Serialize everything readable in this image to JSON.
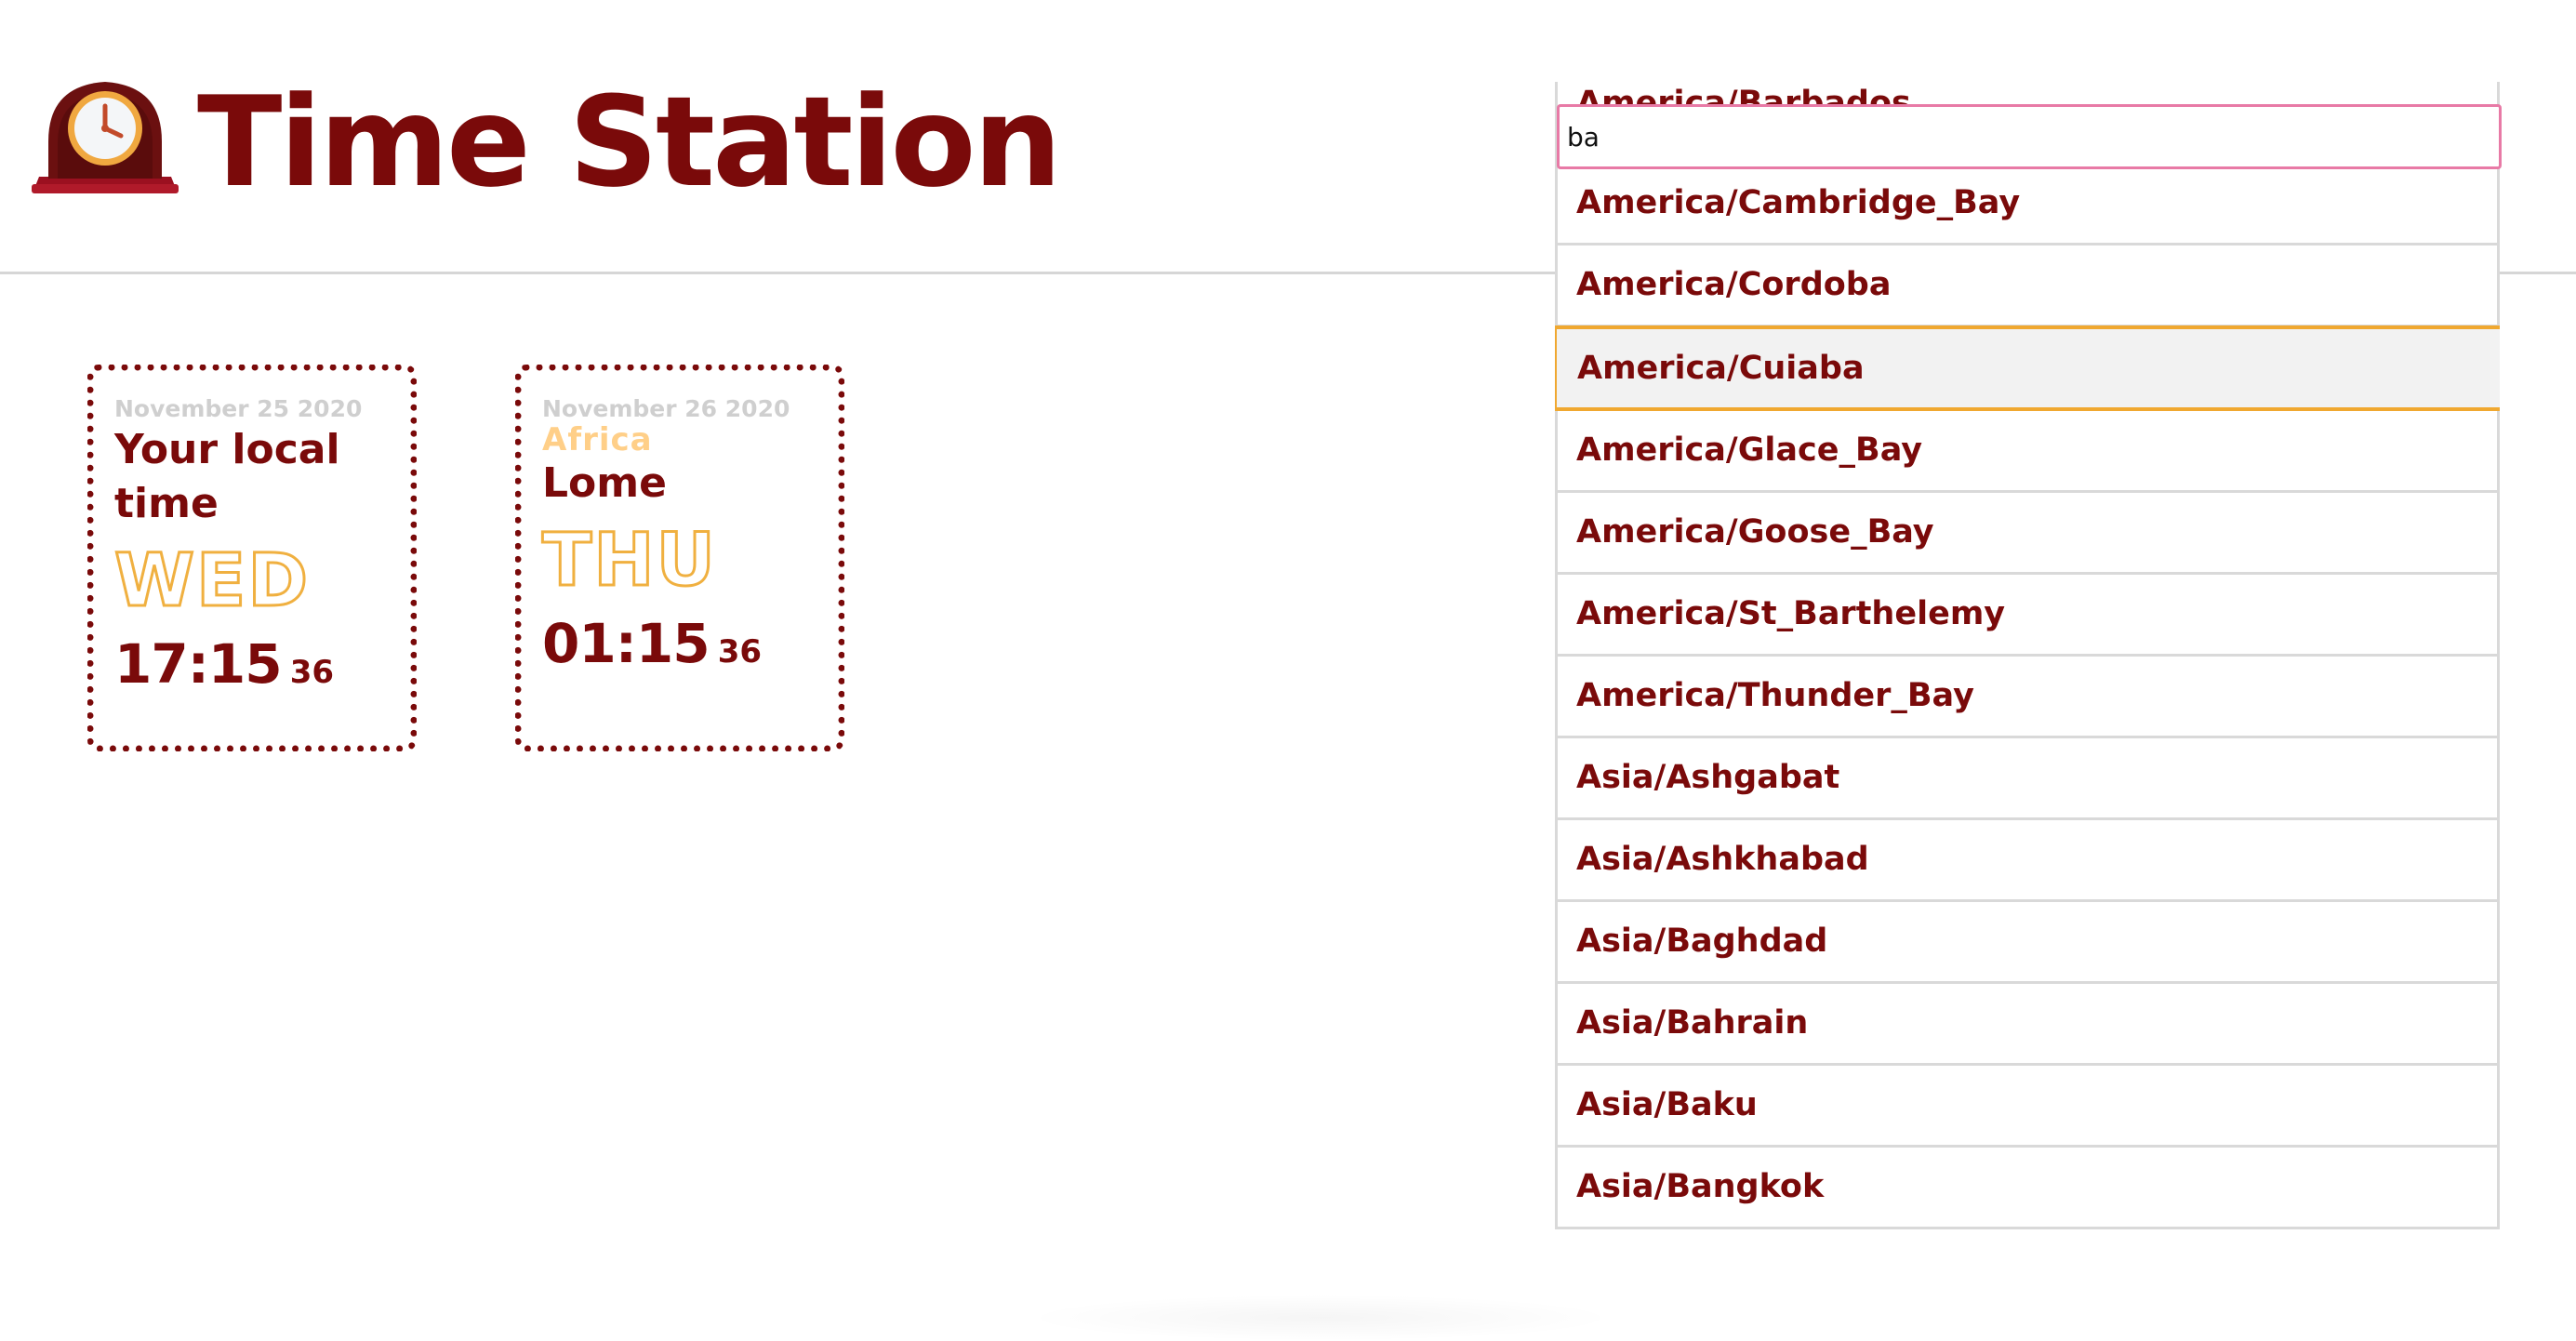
{
  "app": {
    "title": "Time Station",
    "logo_icon": "mantel-clock-icon"
  },
  "colors": {
    "brand": "#7a0a0a",
    "accent": "#f0b040",
    "region": "#ffcf88",
    "date": "#cfcfcf",
    "input_focus_border": "#e87aa6",
    "highlight_border": "#f0a830"
  },
  "cards": [
    {
      "date": "November 25 2020",
      "region": "",
      "name": "Your local time",
      "day": "WED",
      "time": "17:15",
      "seconds": "36"
    },
    {
      "date": "November 26 2020",
      "region": "Africa",
      "name": "Lome",
      "day": "THU",
      "time": "01:15",
      "seconds": "36"
    }
  ],
  "search": {
    "value": "ba",
    "placeholder": ""
  },
  "suggestions": {
    "highlighted_index": 3,
    "items": [
      "America/Barbados",
      "America/Cambridge_Bay",
      "America/Cordoba",
      "America/Cuiaba",
      "America/Glace_Bay",
      "America/Goose_Bay",
      "America/St_Barthelemy",
      "America/Thunder_Bay",
      "Asia/Ashgabat",
      "Asia/Ashkhabad",
      "Asia/Baghdad",
      "Asia/Bahrain",
      "Asia/Baku",
      "Asia/Bangkok"
    ]
  }
}
